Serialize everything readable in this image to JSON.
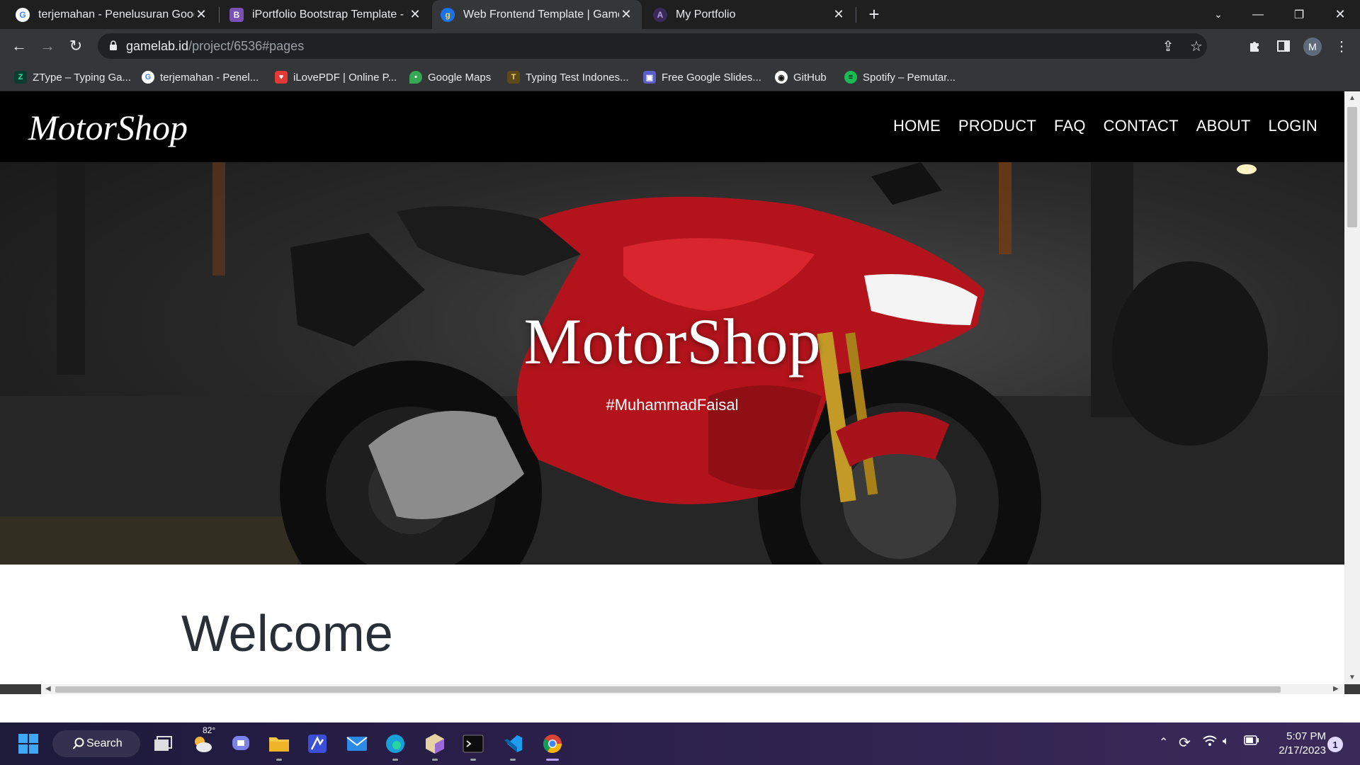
{
  "browser": {
    "tabs": [
      {
        "title": "terjemahan - Penelusuran Google",
        "icon": "google-icon",
        "active": false
      },
      {
        "title": "iPortfolio Bootstrap Template - Ind",
        "icon": "bootstrap-icon",
        "active": false
      },
      {
        "title": "Web Frontend Template | Gamelab",
        "icon": "gamelab-icon",
        "active": true
      },
      {
        "title": "My Portfolio",
        "icon": "portfolio-icon",
        "active": false
      }
    ],
    "url_host": "gamelab.id",
    "url_path": "/project/6536#pages",
    "profile_initial": "M",
    "bookmarks": [
      {
        "label": "ZType – Typing Ga...",
        "icon": "ztype-icon"
      },
      {
        "label": "terjemahan - Penel...",
        "icon": "google-icon"
      },
      {
        "label": "iLovePDF | Online P...",
        "icon": "ilovepdf-icon"
      },
      {
        "label": "Google Maps",
        "icon": "maps-icon"
      },
      {
        "label": "Typing Test Indones...",
        "icon": "typing-icon"
      },
      {
        "label": "Free Google Slides...",
        "icon": "slides-icon"
      },
      {
        "label": "GitHub",
        "icon": "github-icon"
      },
      {
        "label": "Spotify – Pemutar...",
        "icon": "spotify-icon"
      }
    ]
  },
  "site": {
    "brand": "MotorShop",
    "nav": [
      "HOME",
      "PRODUCT",
      "FAQ",
      "CONTACT",
      "ABOUT",
      "LOGIN"
    ],
    "hero_title": "MotorShop",
    "hero_subtitle": "#MuhammadFaisal",
    "welcome": "Welcome"
  },
  "taskbar": {
    "search_label": "Search",
    "weather": "82°",
    "time": "5:07 PM",
    "date": "2/17/2023",
    "notifications": "1"
  },
  "colors": {
    "chrome_dark": "#1f1f1f",
    "toolbar": "#35363a",
    "site_nav": "#000000",
    "bike_red": "#b3141b"
  }
}
